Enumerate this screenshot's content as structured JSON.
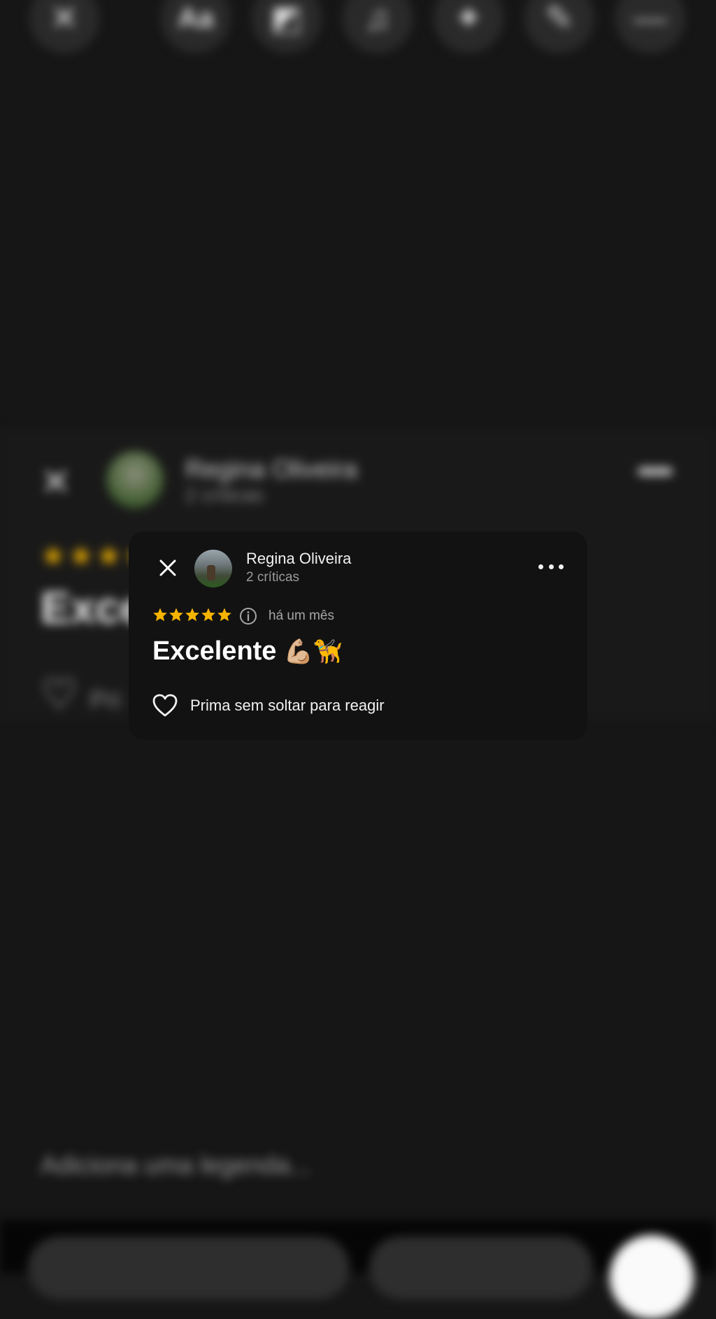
{
  "background": {
    "toolbar_icons": [
      "close-icon",
      "text-aa-icon",
      "sticker-icon",
      "music-icon",
      "effects-icon",
      "draw-icon",
      "more-icon"
    ],
    "toolbar_glyphs": [
      "✕",
      "Aa",
      "◩",
      "♫",
      "✦",
      "✎",
      "—"
    ],
    "card_name": "Regina Oliveira",
    "card_reviews": "2 críticas",
    "card_title": "Exce",
    "card_stars": "★★★★",
    "react_partial": "Pri",
    "caption_placeholder": "Adiciona uma legenda..."
  },
  "review_card": {
    "reviewer_name": "Regina Oliveira",
    "review_count": "2 críticas",
    "rating": 5,
    "rating_max": 5,
    "time_ago": "há um mês",
    "review_text": "Excelente",
    "emojis": "💪🏼🦮",
    "react_hint": "Prima sem soltar para reagir",
    "star_color": "#F4B400"
  }
}
